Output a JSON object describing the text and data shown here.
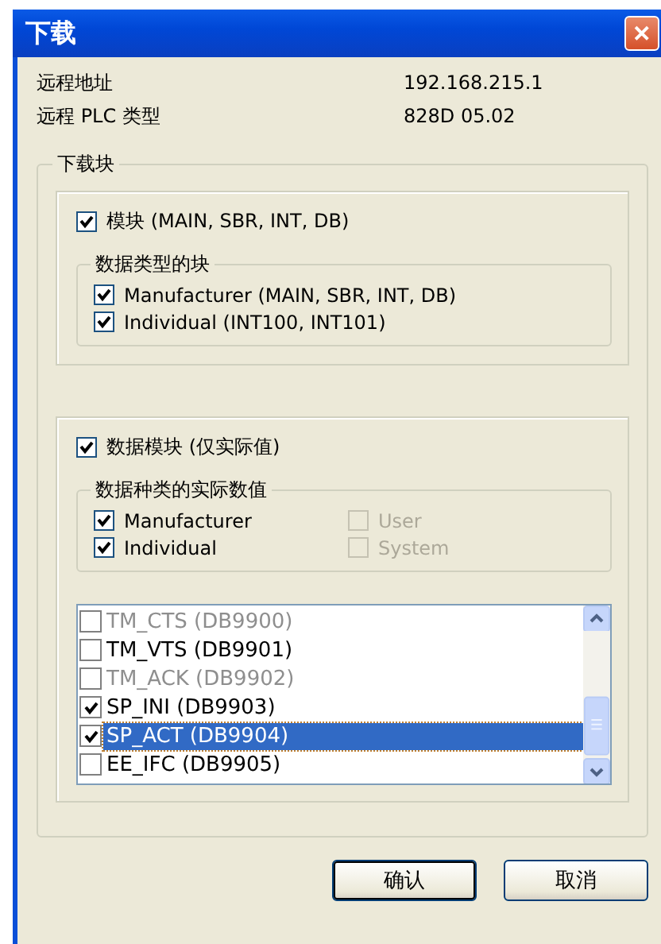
{
  "window": {
    "title": "下载",
    "close": "✕"
  },
  "info": [
    {
      "label": "远程地址",
      "value": "192.168.215.1"
    },
    {
      "label": "远程 PLC 类型",
      "value": "828D 05.02"
    }
  ],
  "download_group": {
    "title": "下载块",
    "blocks": {
      "label": "模块 (MAIN, SBR, INT, DB)",
      "checked": true,
      "disabled": false,
      "subgroup": {
        "title": "数据类型的块",
        "options": [
          {
            "label": "Manufacturer (MAIN, SBR, INT, DB)",
            "checked": true,
            "disabled": false
          },
          {
            "label": "Individual (INT100, INT101)",
            "checked": true,
            "disabled": false
          }
        ]
      }
    },
    "data_blocks": {
      "label": "数据模块 (仅实际值)",
      "checked": true,
      "disabled": false,
      "subgroup": {
        "title": "数据种类的实际数值",
        "options": [
          {
            "label": "Manufacturer",
            "checked": true,
            "disabled": false
          },
          {
            "label": "User",
            "checked": false,
            "disabled": true
          },
          {
            "label": "Individual",
            "checked": true,
            "disabled": false
          },
          {
            "label": "System",
            "checked": false,
            "disabled": true
          }
        ]
      },
      "list": [
        {
          "label": "TM_CTS (DB9900)",
          "checked": false,
          "disabled": true,
          "selected": false
        },
        {
          "label": "TM_VTS (DB9901)",
          "checked": false,
          "disabled": false,
          "selected": false
        },
        {
          "label": "TM_ACK (DB9902)",
          "checked": false,
          "disabled": true,
          "selected": false
        },
        {
          "label": "SP_INI (DB9903)",
          "checked": true,
          "disabled": false,
          "selected": false
        },
        {
          "label": "SP_ACT (DB9904)",
          "checked": true,
          "disabled": false,
          "selected": true
        },
        {
          "label": "EE_IFC (DB9905)",
          "checked": false,
          "disabled": false,
          "selected": false
        }
      ]
    }
  },
  "buttons": [
    {
      "label": "确认",
      "default": true
    },
    {
      "label": "取消",
      "default": false
    }
  ]
}
